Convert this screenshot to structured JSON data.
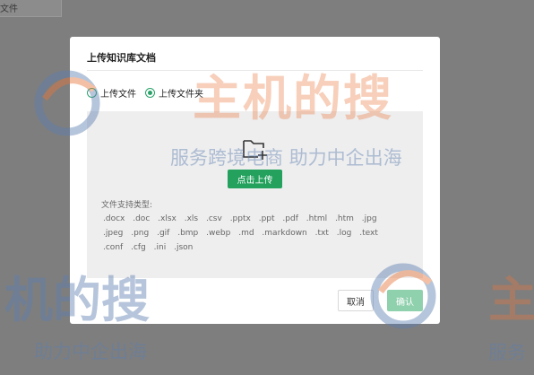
{
  "background": {
    "card_label": "文件"
  },
  "modal": {
    "title": "上传知识库文档",
    "radios": [
      {
        "label": "上传文件",
        "selected": false
      },
      {
        "label": "上传文件夹",
        "selected": true
      }
    ],
    "upload_button": "点击上传",
    "types_title": "文件支持类型:",
    "types": [
      ".docx",
      ".doc",
      ".xlsx",
      ".xls",
      ".csv",
      ".pptx",
      ".ppt",
      ".pdf",
      ".html",
      ".htm",
      ".jpg",
      ".jpeg",
      ".png",
      ".gif",
      ".bmp",
      ".webp",
      ".md",
      ".markdown",
      ".txt",
      ".log",
      ".text",
      ".conf",
      ".cfg",
      ".ini",
      ".json"
    ],
    "cancel": "取消",
    "confirm": "确认"
  },
  "watermark": {
    "brand": "主机的搜",
    "slogan": "服务跨境电商 助力中企出海",
    "left_fragment": "机的搜",
    "left_slogan": "助力中企出海",
    "right_fragment": "主",
    "right_slogan": "服务"
  },
  "colors": {
    "accent": "#23a15d",
    "watermark_orange": "#e8763a",
    "watermark_blue": "#5d7fb0"
  }
}
